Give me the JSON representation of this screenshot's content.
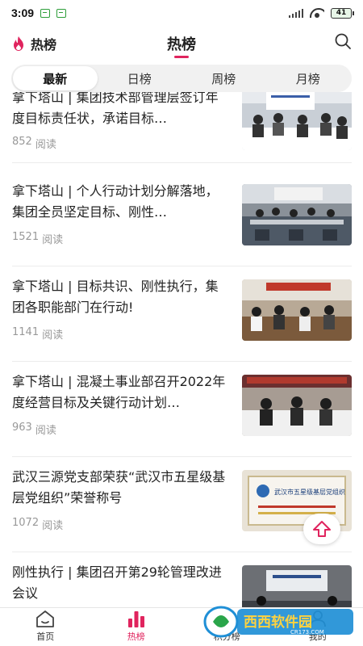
{
  "status_bar": {
    "time": "3:09",
    "battery": "41"
  },
  "header": {
    "left_label": "热榜",
    "title": "热榜"
  },
  "tabs": [
    {
      "label": "最新",
      "active": true
    },
    {
      "label": "日榜",
      "active": false
    },
    {
      "label": "周榜",
      "active": false
    },
    {
      "label": "月榜",
      "active": false
    }
  ],
  "articles": [
    {
      "title": "拿下塔山 | 集团技术部管理层签订年度目标责任状，承诺目标…",
      "reads": "852",
      "reads_unit": "阅读"
    },
    {
      "title": "拿下塔山 | 个人行动计划分解落地，集团全员坚定目标、刚性…",
      "reads": "1521",
      "reads_unit": "阅读"
    },
    {
      "title": "拿下塔山 | 目标共识、刚性执行，集团各职能部门在行动!",
      "reads": "1141",
      "reads_unit": "阅读"
    },
    {
      "title": "拿下塔山 | 混凝土事业部召开2022年度经营目标及关键行动计划…",
      "reads": "963",
      "reads_unit": "阅读"
    },
    {
      "title": "武汉三源党支部荣获“武汉市五星级基层党组织”荣誉称号",
      "reads": "1072",
      "reads_unit": "阅读",
      "thumb_caption": "武汉市五星级基层党组织"
    },
    {
      "title": "刚性执行 | 集团召开第29轮管理改进会议",
      "reads": "",
      "reads_unit": ""
    }
  ],
  "bottom_nav": [
    {
      "label": "首页",
      "icon": "home-icon",
      "active": false
    },
    {
      "label": "热榜",
      "icon": "bar-chart-icon",
      "active": true
    },
    {
      "label": "积分榜",
      "icon": "trophy-icon",
      "active": false
    },
    {
      "label": "我的",
      "icon": "user-icon",
      "active": false
    }
  ],
  "watermark": {
    "text": "西西软件园",
    "url_text": "CR173.COM"
  },
  "colors": {
    "accent": "#e0245e",
    "text": "#222222",
    "muted": "#999999",
    "tab_bg": "#f1f1f1"
  }
}
